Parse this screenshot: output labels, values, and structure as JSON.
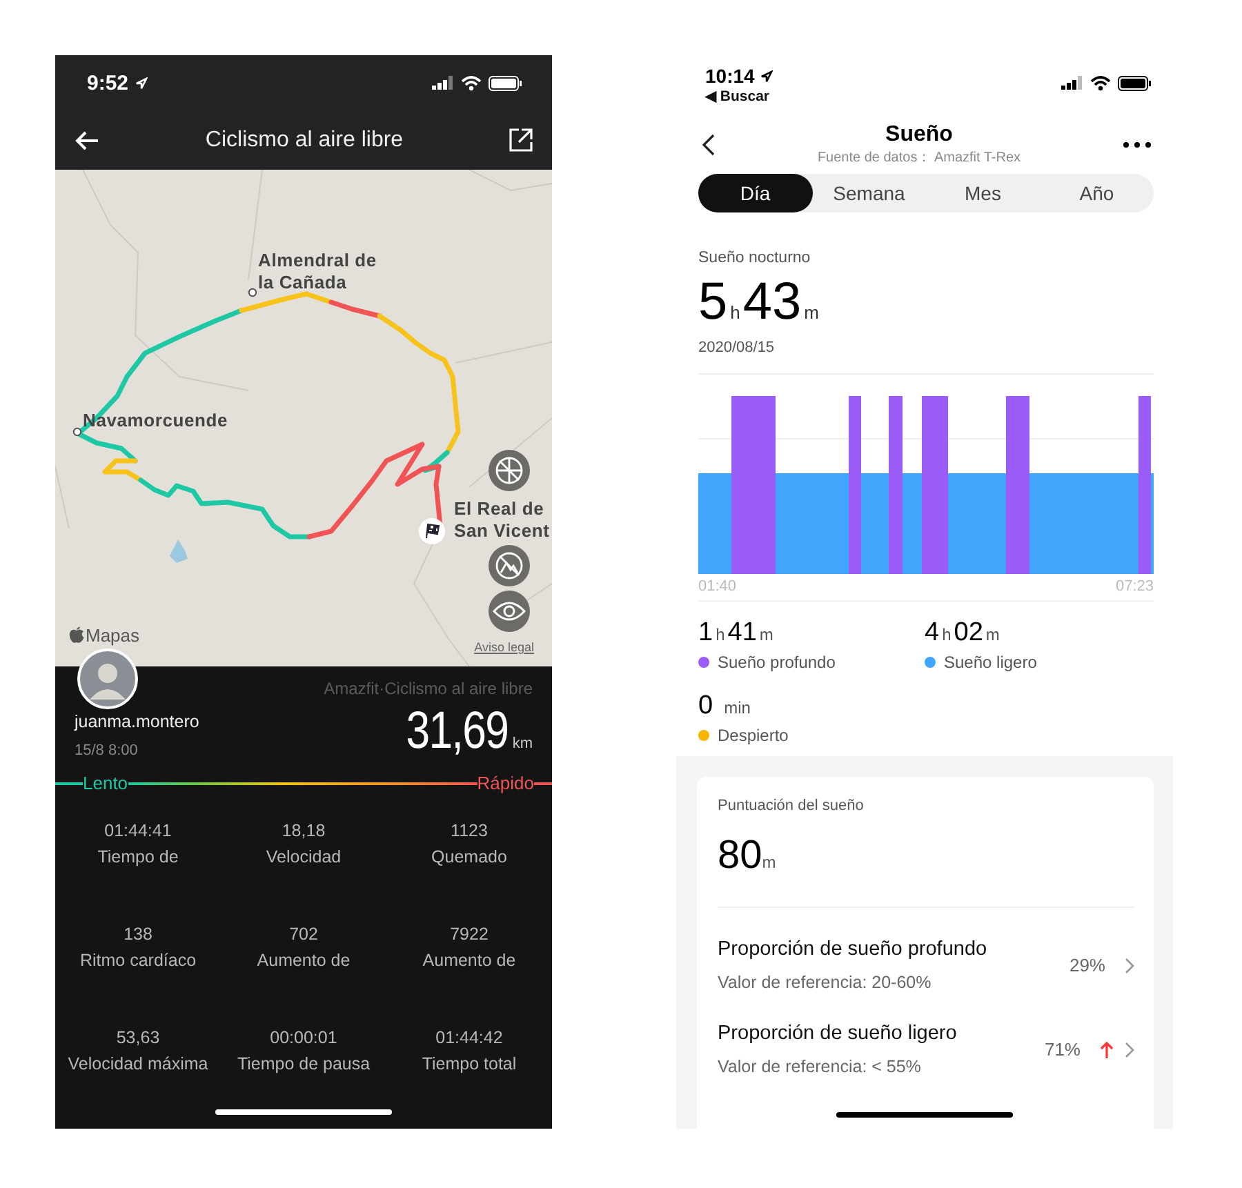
{
  "left_screen": {
    "status_bar": {
      "time": "9:52"
    },
    "header": {
      "title": "Ciclismo al aire libre"
    },
    "map": {
      "places": [
        {
          "name": "Almendral de\nla Cañada"
        },
        {
          "name": "Navamorcuende"
        },
        {
          "name": "El Real de\nSan Vicent"
        }
      ],
      "attribution": "Mapas",
      "legal_link": "Aviso legal"
    },
    "summary": {
      "source": "Amazfit·Ciclismo al aire libre",
      "user": "juanma.montero",
      "date": "15/8 8:00",
      "distance": "31,69",
      "unit": "km"
    },
    "speed_legend": {
      "slow": "Lento",
      "fast": "Rápido"
    },
    "stats": [
      {
        "value": "01:44:41",
        "label": "Tiempo de"
      },
      {
        "value": "18,18",
        "label": "Velocidad"
      },
      {
        "value": "1123",
        "label": "Quemado"
      },
      {
        "value": "138",
        "label": "Ritmo cardíaco"
      },
      {
        "value": "702",
        "label": "Aumento de"
      },
      {
        "value": "7922",
        "label": "Aumento de"
      },
      {
        "value": "53,63",
        "label": "Velocidad máxima"
      },
      {
        "value": "00:00:01",
        "label": "Tiempo de pausa"
      },
      {
        "value": "01:44:42",
        "label": "Tiempo total"
      }
    ]
  },
  "right_screen": {
    "status_bar": {
      "time": "10:14",
      "back_app": "◀ Buscar"
    },
    "header": {
      "title": "Sueño",
      "subtitle": "Fuente de datos： Amazfit T-Rex"
    },
    "tabs": [
      {
        "label": "Día",
        "selected": true
      },
      {
        "label": "Semana",
        "selected": false
      },
      {
        "label": "Mes",
        "selected": false
      },
      {
        "label": "Año",
        "selected": false
      }
    ],
    "night_sleep": {
      "label": "Sueño nocturno",
      "hours": "5",
      "hours_unit": "h",
      "minutes": "43",
      "minutes_unit": "m",
      "date": "2020/08/15"
    },
    "chart": {
      "start": "01:40",
      "end": "07:23"
    },
    "breakdown": [
      {
        "kind": "hm",
        "hours": "1",
        "hours_unit": "h",
        "minutes": "41",
        "minutes_unit": "m",
        "label": "Sueño profundo",
        "color": "#9b5cf8"
      },
      {
        "kind": "hm",
        "hours": "4",
        "hours_unit": "h",
        "minutes": "02",
        "minutes_unit": "m",
        "label": "Sueño ligero",
        "color": "#40a6fb"
      },
      {
        "kind": "min",
        "value": "0",
        "unit": "min",
        "label": "Despierto",
        "color": "#f7b500"
      }
    ],
    "score": {
      "label": "Puntuación del sueño",
      "value": "80",
      "unit": "m"
    },
    "ratios": [
      {
        "title": "Proporción de sueño profundo",
        "reference": "Valor de referencia: 20-60%",
        "value": "29%",
        "trend_up": false
      },
      {
        "title": "Proporción de sueño ligero",
        "reference": "Valor de referencia: < 55%",
        "value": "71%",
        "trend_up": true
      }
    ]
  }
}
